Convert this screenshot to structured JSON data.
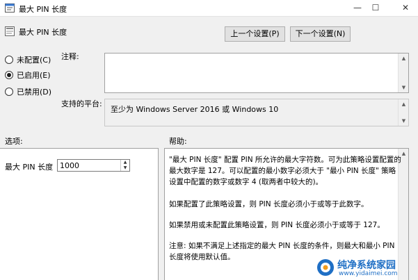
{
  "window": {
    "title": "最大 PIN 长度",
    "minimize_glyph": "—",
    "maximize_glyph": "☐",
    "close_glyph": "✕"
  },
  "header": {
    "policy_name": "最大 PIN 长度",
    "prev_button": "上一个设置(P)",
    "next_button": "下一个设置(N)"
  },
  "state": {
    "options": [
      {
        "label": "未配置(C)",
        "selected": false
      },
      {
        "label": "已启用(E)",
        "selected": true
      },
      {
        "label": "已禁用(D)",
        "selected": false
      }
    ]
  },
  "comment": {
    "label": "注释:",
    "value": ""
  },
  "supported": {
    "label": "支持的平台:",
    "value": "至少为 Windows Server 2016 或 Windows 10"
  },
  "options_section": {
    "label": "选项:",
    "field_label": "最大 PIN 长度",
    "field_value": "1000"
  },
  "help_section": {
    "label": "帮助:",
    "paragraphs": [
      "\"最大 PIN 长度\" 配置 PIN 所允许的最大字符数。可为此策略设置配置的最大数字是 127。可以配置的最小数字必须大于 \"最小 PIN 长度\" 策略设置中配置的数字或数字 4 (取两者中较大的)。",
      "如果配置了此策略设置，则 PIN 长度必须小于或等于此数字。",
      "如果禁用或未配置此策略设置，则 PIN 长度必须小于或等于 127。",
      "注意: 如果不满足上述指定的最大 PIN 长度的条件，则最大和最小 PIN 长度将使用默认值。"
    ]
  },
  "watermark": {
    "title": "纯净系统家园",
    "url": "www.yidaimei.com"
  },
  "colors": {
    "accent": "#1f6fc5",
    "background": "#f0f0f0"
  }
}
